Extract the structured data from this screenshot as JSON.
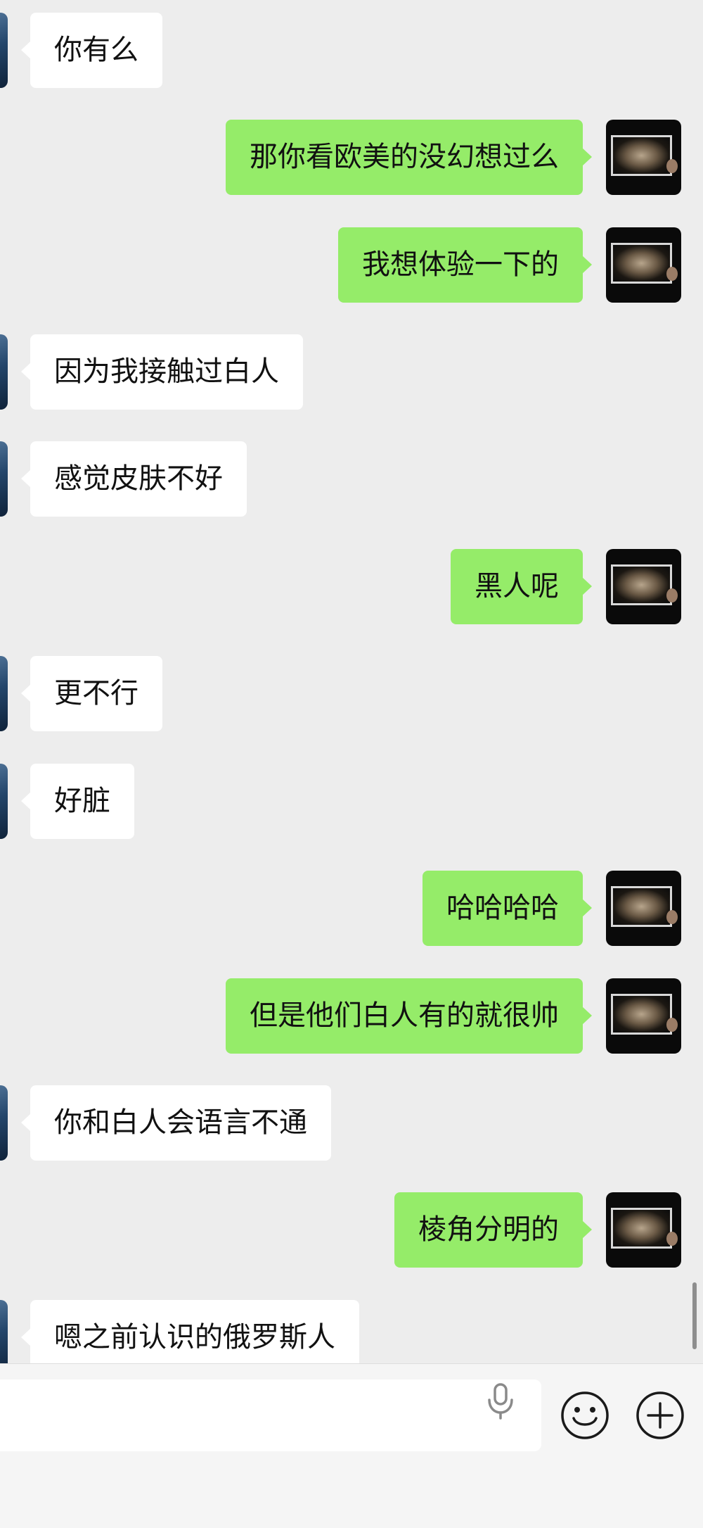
{
  "messages": [
    {
      "side": "left",
      "text": "你有么"
    },
    {
      "side": "right",
      "text": "那你看欧美的没幻想过么"
    },
    {
      "side": "right",
      "text": "我想体验一下的"
    },
    {
      "side": "left",
      "text": "因为我接触过白人"
    },
    {
      "side": "left",
      "text": "感觉皮肤不好"
    },
    {
      "side": "right",
      "text": "黑人呢"
    },
    {
      "side": "left",
      "text": "更不行"
    },
    {
      "side": "left",
      "text": "好脏"
    },
    {
      "side": "right",
      "text": "哈哈哈哈"
    },
    {
      "side": "right",
      "text": "但是他们白人有的就很帅"
    },
    {
      "side": "left",
      "text": "你和白人会语言不通"
    },
    {
      "side": "right",
      "text": "棱角分明的"
    },
    {
      "side": "left",
      "text": "嗯之前认识的俄罗斯人"
    }
  ],
  "input_bar": {
    "value": "",
    "voice_icon": "microphone-icon",
    "emoji_icon": "emoji-icon",
    "more_icon": "plus-icon"
  },
  "colors": {
    "background": "#ededed",
    "bubble_self": "#95ec69",
    "bubble_other": "#ffffff",
    "input_bar": "#f5f5f5"
  }
}
